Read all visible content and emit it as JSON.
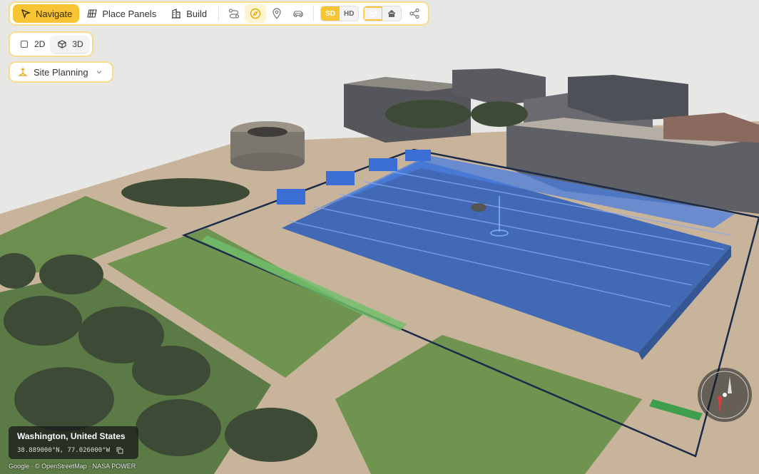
{
  "toolbar": {
    "navigate_label": "Navigate",
    "place_panels_label": "Place Panels",
    "build_label": "Build",
    "quality": {
      "sd": "SD",
      "hd": "HD",
      "selected": "SD"
    }
  },
  "view": {
    "mode_2d": "2D",
    "mode_3d": "3D",
    "selected": "3D"
  },
  "mode_select": {
    "label": "Site Planning"
  },
  "location": {
    "city": "Washington, United States",
    "coords": "38.889000°N, 77.026000°W"
  },
  "attribution": "Google · © OpenStreetMap · NASA POWER",
  "colors": {
    "accent": "#f7c533",
    "panel_blue": "#3a6fd8",
    "outline": "#1c2a4a"
  },
  "icons": [
    "cursor-icon",
    "solar-panel-icon",
    "building-icon",
    "route-icon",
    "compass-icon",
    "pin-icon",
    "car-icon",
    "cube-icon",
    "house-icon",
    "share-icon",
    "checkbox-icon",
    "copy-icon"
  ]
}
